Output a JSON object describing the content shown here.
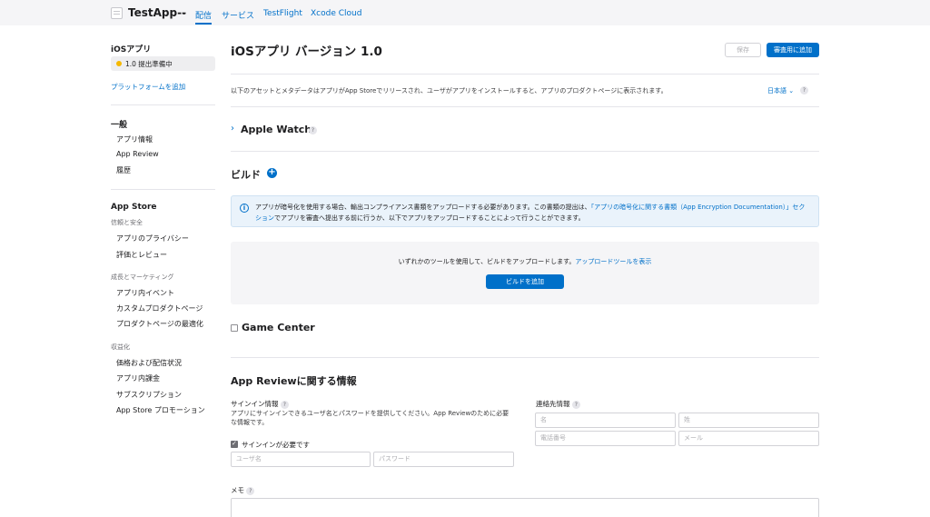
{
  "topbar": {
    "app_name": "TestApp--",
    "chevron": "⌄",
    "nav": [
      "配信",
      "サービス",
      "TestFlight",
      "Xcode Cloud"
    ]
  },
  "sidebar": {
    "platform_title": "iOSアプリ",
    "status": "1.0 提出準備中",
    "status_color": "#f5b800",
    "add_platform": "プラットフォームを追加",
    "general_title": "一般",
    "general_items": [
      "アプリ情報",
      "App Review",
      "履歴"
    ],
    "store_title": "App Store",
    "trust_title": "信頼と安全",
    "trust_items": [
      "アプリのプライバシー",
      "評価とレビュー"
    ],
    "growth_title": "成長とマーケティング",
    "growth_items": [
      "アプリ内イベント",
      "カスタムプロダクトページ",
      "プロダクトページの最適化"
    ],
    "monetize_title": "収益化",
    "monetize_items": [
      "価格および配信状況",
      "アプリ内課金",
      "サブスクリプション",
      "App Store プロモーション"
    ]
  },
  "main": {
    "title": "iOSアプリ バージョン 1.0",
    "save_label": "保存",
    "submit_label": "審査用に追加",
    "description": "以下のアセットとメタデータはアプリがApp Storeでリリースされ、ユーザがアプリをインストールすると、アプリのプロダクトページに表示されます。",
    "language": "日本語 ⌄",
    "help": "?",
    "apple_watch": "Apple Watch",
    "build_title": "ビルド",
    "plus": "+",
    "info_icon": "i",
    "info_text_1": "アプリが暗号化を使用する場合、輸出コンプライアンス書類をアップロードする必要があります。この書類の提出は、",
    "info_link": "「アプリの暗号化に関する書類（App Encryption Documentation）」セクション",
    "info_text_2": "でアプリを審査へ提出する前に行うか、以下でアプリをアップロードすることによって行うことができます。",
    "upload_text": "いずれかのツールを使用して、ビルドをアップロードします。",
    "upload_link": "アップロードツールを表示",
    "add_build_label": "ビルドを追加",
    "game_center": "Game Center",
    "review_title": "App Reviewに関する情報",
    "signin_label": "サインイン情報",
    "signin_help": "アプリにサインインできるユーザ名とパスワードを提供してください。App Reviewのために必要な情報です。",
    "signin_required": "サインインが必要です",
    "username_placeholder": "ユーザ名",
    "password_placeholder": "パスワード",
    "contact_label": "連絡先情報",
    "first_name_placeholder": "名",
    "last_name_placeholder": "姓",
    "phone_placeholder": "電話番号",
    "email_placeholder": "メール",
    "memo_label": "メモ"
  }
}
